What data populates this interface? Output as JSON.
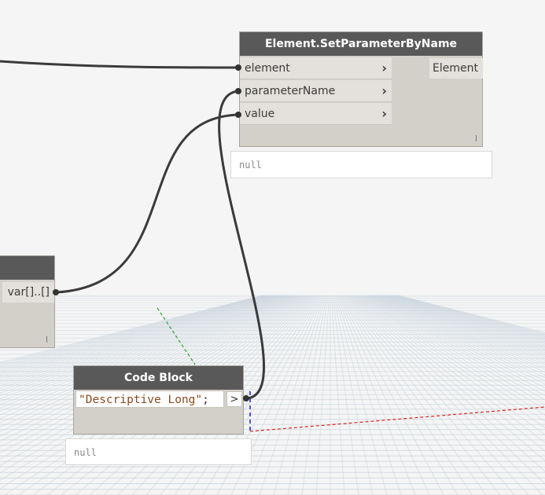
{
  "nodes": {
    "set_parameter": {
      "title": "Element.SetParameterByName",
      "inputs": [
        "element",
        "parameterName",
        "value"
      ],
      "output": "Element",
      "preview": "null"
    },
    "partial_node": {
      "output": "var[]..[]"
    },
    "code_block": {
      "title": "Code Block",
      "code_string": "\"Descriptive Long\"",
      "code_terminator": ";",
      "out_arrow": ">",
      "preview": "null"
    }
  },
  "colors": {
    "canvas": "#f5f5f5",
    "node_header": "#595959",
    "node_body": "#d3cfc9",
    "port_row": "#e4e1dc",
    "wire": "#3a3a3a",
    "grid": "#c8d4dc",
    "axis_x": "#e02020",
    "axis_y": "#2ca02c",
    "axis_z": "#2020e0",
    "code_string": "#8b4a1d"
  }
}
